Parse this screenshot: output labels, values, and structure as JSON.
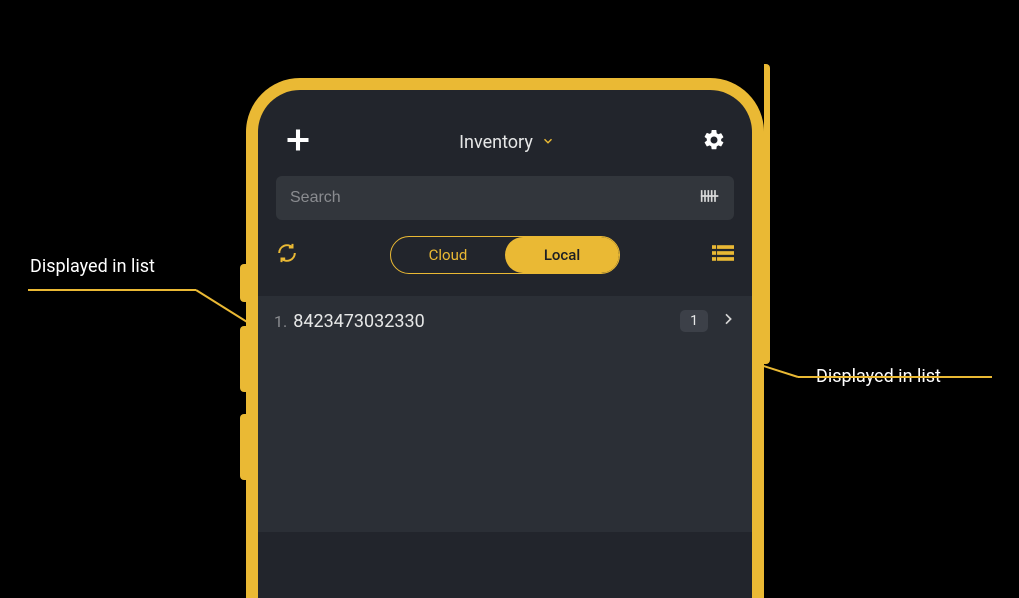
{
  "annotations": {
    "left": "Displayed in list",
    "right": "Displayed in list"
  },
  "header": {
    "title": "Inventory"
  },
  "search": {
    "placeholder": "Search"
  },
  "segments": {
    "cloud": "Cloud",
    "local": "Local"
  },
  "list": {
    "items": [
      {
        "index": "1.",
        "code": "8423473032330",
        "qty": "1"
      }
    ]
  }
}
